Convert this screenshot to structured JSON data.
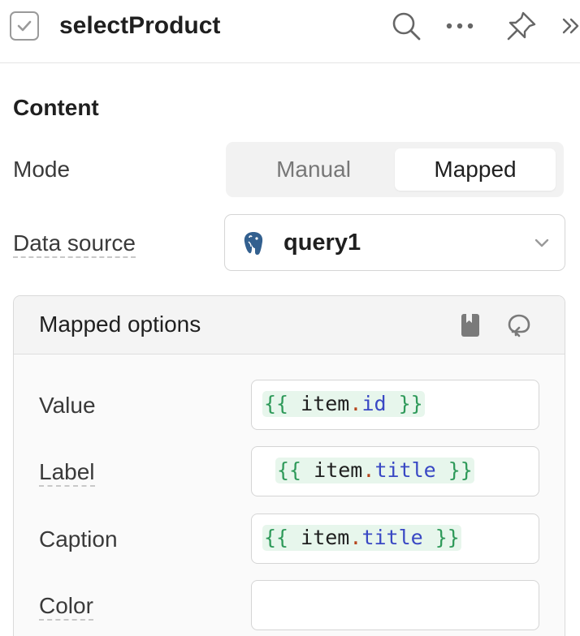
{
  "header": {
    "title": "selectProduct",
    "icons": [
      "checkbox-icon",
      "search-icon",
      "more-icon",
      "pin-icon",
      "expand-icon"
    ]
  },
  "content": {
    "section_title": "Content",
    "mode": {
      "label": "Mode",
      "options": [
        "Manual",
        "Mapped"
      ],
      "selected": "Mapped"
    },
    "data_source": {
      "label": "Data source",
      "value": "query1",
      "icon": "postgresql-icon"
    }
  },
  "mapped_options": {
    "title": "Mapped options",
    "icons": [
      "book-icon",
      "reset-icon"
    ],
    "fields": [
      {
        "label": "Value",
        "code_prefix": "{{ ",
        "code_var": "item",
        "code_dot": ".",
        "code_prop": "id",
        "code_suffix": " }}"
      },
      {
        "label": "Label",
        "code_prefix": "{{ ",
        "code_var": "item",
        "code_dot": ".",
        "code_prop": "title",
        "code_suffix": " }}"
      },
      {
        "label": "Caption",
        "code_prefix": "{{ ",
        "code_var": "item",
        "code_dot": ".",
        "code_prop": "title",
        "code_suffix": " }}"
      },
      {
        "label": "Color",
        "value": ""
      }
    ]
  },
  "colors": {
    "code_brace": "#2f9a5a",
    "code_property": "#3948c4",
    "code_dot": "#b5441b",
    "code_highlight": "#e7f6ec"
  }
}
